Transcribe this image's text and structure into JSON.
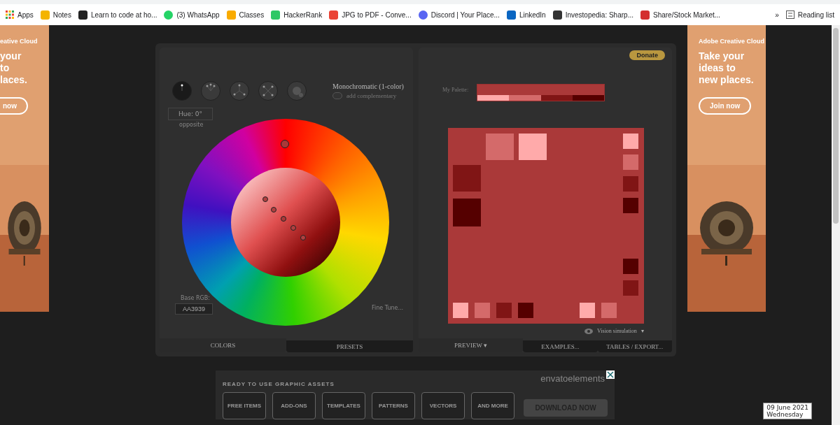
{
  "bookmarks": [
    {
      "label": "Apps"
    },
    {
      "label": "Notes"
    },
    {
      "label": "Learn to code at ho..."
    },
    {
      "label": "(3) WhatsApp"
    },
    {
      "label": "Classes"
    },
    {
      "label": "HackerRank"
    },
    {
      "label": "JPG to PDF - Conve..."
    },
    {
      "label": "Discord | Your Place..."
    },
    {
      "label": "LinkedIn"
    },
    {
      "label": "Investopedia: Sharp..."
    },
    {
      "label": "Share/Stock Market..."
    }
  ],
  "bookmarks_more": "»",
  "reading_list": "Reading list",
  "left_ad": {
    "brand": "eative Cloud",
    "lines": [
      "your",
      "to",
      "laces."
    ],
    "button": "now"
  },
  "right_ad": {
    "brand": "Adobe Creative Cloud",
    "lines": [
      "Take your",
      "ideas to",
      "new places."
    ],
    "button": "Join now"
  },
  "app": {
    "donate": "Donate",
    "schemes": [
      {
        "kind": "mono",
        "selected": true
      },
      {
        "kind": "adjacent",
        "selected": false
      },
      {
        "kind": "triad",
        "selected": false
      },
      {
        "kind": "tetrad",
        "selected": false
      },
      {
        "kind": "free",
        "selected": false
      }
    ],
    "scheme_label": "Monochromatic (1-color)",
    "add_complementary": {
      "label": "add complementary",
      "on": false
    },
    "hue": "Hue: 0°",
    "opposite": "opposite",
    "base_rgb_label": "Base RGB:",
    "base_rgb": "AA3939",
    "fine_tune": "Fine Tune...",
    "left_tabs": [
      {
        "label": "COLORS",
        "selected": true
      },
      {
        "label": "PRESETS",
        "selected": false
      }
    ],
    "palette_label": "My Palette:",
    "palette": {
      "swatches": [
        {
          "kind": "base",
          "color": "#aa3939"
        },
        {
          "kind": "shade",
          "color": "#ffaaaa"
        },
        {
          "kind": "shade",
          "color": "#d46a6a"
        },
        {
          "kind": "shade",
          "color": "#801515"
        },
        {
          "kind": "shade",
          "color": "#550000"
        }
      ]
    },
    "preview": {
      "swatches": [
        {
          "color": "#d46a6a"
        },
        {
          "color": "#ffaaaa"
        },
        {
          "color": "#ffaaaa"
        },
        {
          "color": "#d46a6a"
        },
        {
          "color": "#801515"
        },
        {
          "color": "#550000"
        },
        {
          "color": "#801515"
        },
        {
          "color": "#550000"
        },
        {
          "color": "#550000"
        },
        {
          "color": "#801515"
        },
        {
          "color": "#ffaaaa"
        },
        {
          "color": "#d46a6a"
        },
        {
          "color": "#801515"
        },
        {
          "color": "#550000"
        },
        {
          "color": "#ffaaaa"
        },
        {
          "color": "#d46a6a"
        }
      ]
    },
    "vision": "Vision simulation",
    "vision_caret": "▾",
    "right_tabs": [
      {
        "label": "PREVIEW ▾",
        "selected": true
      },
      {
        "label": "EXAMPLES...",
        "selected": false
      },
      {
        "label": "TABLES / EXPORT...",
        "selected": false
      }
    ]
  },
  "envato": {
    "heading": "READY TO USE GRAPHIC ASSETS",
    "buttons": [
      "FREE ITEMS",
      "ADD-ONS",
      "TEMPLATES",
      "PATTERNS",
      "VECTORS",
      "AND MORE"
    ],
    "logo": "envatoelements",
    "cta": "DOWNLOAD NOW"
  },
  "clock": {
    "date": "09 June 2021",
    "day": "Wednesday"
  }
}
